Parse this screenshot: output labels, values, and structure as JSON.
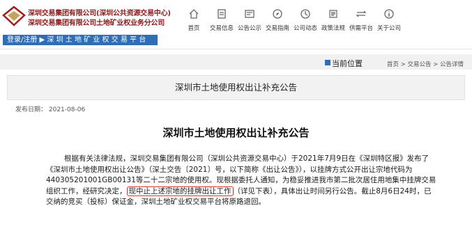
{
  "header": {
    "org_line1": "深圳交易集团有限公司(深圳公共资源交易中心)",
    "org_line2": "深圳交易集团有限公司土地矿业权业务分公司",
    "login_bar": "登录/注册 ▶ 深 圳 土 地 矿 业 权 交 易 平 台"
  },
  "nav": [
    {
      "label": "首页",
      "icon": "home-icon"
    },
    {
      "label": "交易信息",
      "icon": "trade-info-icon"
    },
    {
      "label": "公告公示",
      "icon": "announcement-icon"
    },
    {
      "label": "交易指南",
      "icon": "guide-icon"
    },
    {
      "label": "公司动态",
      "icon": "company-news-icon"
    },
    {
      "label": "政策法规",
      "icon": "policy-icon"
    },
    {
      "label": "供需平台",
      "icon": "supply-demand-icon"
    },
    {
      "label": "关于公司",
      "icon": "about-icon"
    }
  ],
  "breadcrumb": {
    "title": "当前位置",
    "path": "首页 > 交易公告 > 公告详情"
  },
  "notice": {
    "box_title": "深圳市土地使用权出让补充公告",
    "date": "发布日期： 2021-08-06",
    "heading": "深圳市土地使用权出让补充公告",
    "p1": "根据有关法律法规，深圳交易集团有限公司（深圳公共资源交易中心）于2021年7月9日在《深圳特区报》发布了《深圳市土地使用权出让公告》（深土交告〔2021〕号，以下简称《出让公告》），以挂牌方式公开出让宗地代码为440305201001GB00131等二十二宗地的使用权。现根据委托人通知，为稳妥推进我市第二批次居住用地集中挂牌交易组织工作，经研究决定，",
    "p1_highlight": "现中止上述宗地的挂牌出让工作",
    "p1_tail": "（详见下表），具体出让时间另行公告。截止8月6日24时，已交纳的竞买（投标）保证金，深圳土地矿业权交易平台将原路退回。"
  },
  "colors": {
    "brand_red": "#8a1a1a",
    "login_blue": "#2f6eb6",
    "highlight_red": "#d9362b"
  }
}
